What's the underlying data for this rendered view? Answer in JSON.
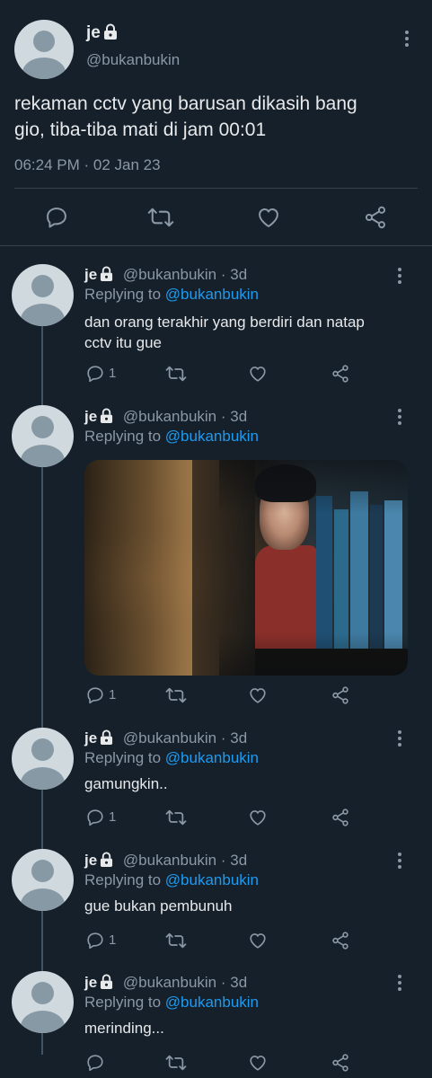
{
  "main_tweet": {
    "display_name": "je",
    "handle": "@bukanbukin",
    "text_line1": "rekaman cctv yang barusan dikasih bang",
    "text_line2": "gio, tiba-tiba mati di jam 00:01",
    "timestamp": "06:24 PM · 02 Jan 23",
    "actions": [
      "reply-icon",
      "retweet-icon",
      "like-icon",
      "share-icon"
    ]
  },
  "replies": [
    {
      "display_name": "je",
      "handle": "@bukanbukin",
      "time": "· 3d",
      "replying_label": "Replying to",
      "replying_to": "@bukanbukin",
      "text_line1": "dan orang terakhir yang berdiri dan natap",
      "text_line2": "cctv itu gue",
      "reply_count": "1"
    },
    {
      "display_name": "je",
      "handle": "@bukanbukin",
      "time": "· 3d",
      "replying_label": "Replying to",
      "replying_to": "@bukanbukin",
      "media": "photo of person peeking from behind a bookshelf",
      "reply_count": "1"
    },
    {
      "display_name": "je",
      "handle": "@bukanbukin",
      "time": "· 3d",
      "replying_label": "Replying to",
      "replying_to": "@bukanbukin",
      "text_line1": "gamungkin..",
      "reply_count": "1"
    },
    {
      "display_name": "je",
      "handle": "@bukanbukin",
      "time": "· 3d",
      "replying_label": "Replying to",
      "replying_to": "@bukanbukin",
      "text_line1": "gue bukan pembunuh",
      "reply_count": "1"
    },
    {
      "display_name": "je",
      "handle": "@bukanbukin",
      "time": "· 3d",
      "replying_label": "Replying to",
      "replying_to": "@bukanbukin",
      "text_line1": "merinding...",
      "reply_count": ""
    }
  ],
  "colors": {
    "background": "#15202b",
    "text": "#e7e9ea",
    "muted": "#8b98a5",
    "link": "#1d9bf0",
    "divider": "#38444d"
  }
}
